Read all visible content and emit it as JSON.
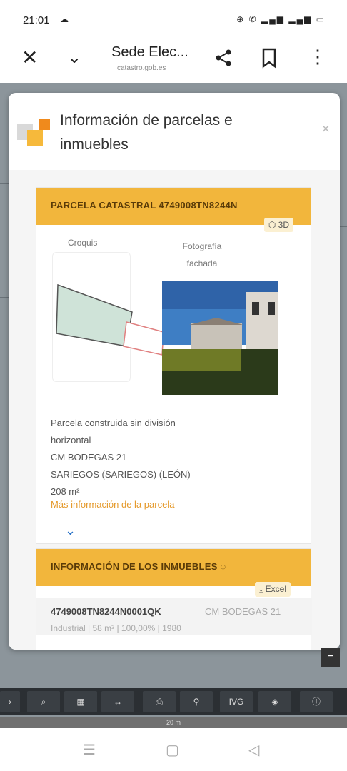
{
  "status_bar": {
    "time": "21:01",
    "cloud_icon": "cloud-icon",
    "icons_text": "⊕ ✆ ▂▄▆ ▂▄▆ ▭"
  },
  "browser": {
    "title": "Sede Elec...",
    "url": "catastro.gob.es",
    "close_icon": "close-icon",
    "chevron_icon": "chevron-down-icon",
    "share_icon": "share-icon",
    "bookmark_icon": "bookmark-icon",
    "more_icon": "more-vert-icon"
  },
  "modal": {
    "title": "Información de parcelas e inmuebles",
    "close_label": "×",
    "colors": {
      "accent": "#f2b63c",
      "link": "#e59a2c",
      "logo_orange": "#f08a1c",
      "logo_yellow": "#f6b93b"
    }
  },
  "parcela": {
    "header": "PARCELA CATASTRAL 4749008TN8244N",
    "btn_3d": "3D",
    "croquis_label": "Croquis",
    "foto_label": "Fotografía fachada",
    "description_lines": [
      "Parcela construida sin división",
      "horizontal",
      "CM BODEGAS 21",
      "SARIEGOS (SARIEGOS) (LEÓN)",
      "208 m²"
    ],
    "more_link": "Más información de la parcela",
    "expand_icon": "chevron-down-icon"
  },
  "inmuebles": {
    "header": "INFORMACIÓN DE LOS INMUEBLES",
    "excel_label": "Excel",
    "rows": [
      {
        "ref": "4749008TN8244N0001QK",
        "address": "CM BODEGAS 21",
        "detail": "Industrial | 58 m² | 100,00% | 1980"
      }
    ]
  },
  "map_toolbar": {
    "buttons": [
      "›",
      "⌕",
      "▦",
      "↔",
      "⎙",
      "⚲",
      "IVG",
      "◈",
      "ⓘ"
    ]
  },
  "map": {
    "zoom_out": "−",
    "scale_text": "20 m"
  },
  "nav": {
    "menu": "☰",
    "home": "▢",
    "back": "◁"
  }
}
